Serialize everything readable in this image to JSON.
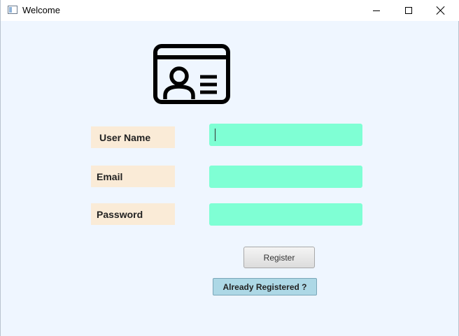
{
  "window": {
    "title": "Welcome",
    "controls": [
      "minimize-icon",
      "maximize-icon",
      "close-icon"
    ]
  },
  "header_icon": "id-card-icon",
  "form": {
    "username_label": "User Name",
    "username_value": "",
    "email_label": "Email",
    "email_value": "",
    "password_label": "Password",
    "password_value": "",
    "register_label": "Register",
    "already_registered_label": "Already Registered ?"
  },
  "colors": {
    "window_background": "#eff6ff",
    "label_background": "#faebd7",
    "input_background": "#7fffd4",
    "secondary_button": "#add8e6"
  }
}
